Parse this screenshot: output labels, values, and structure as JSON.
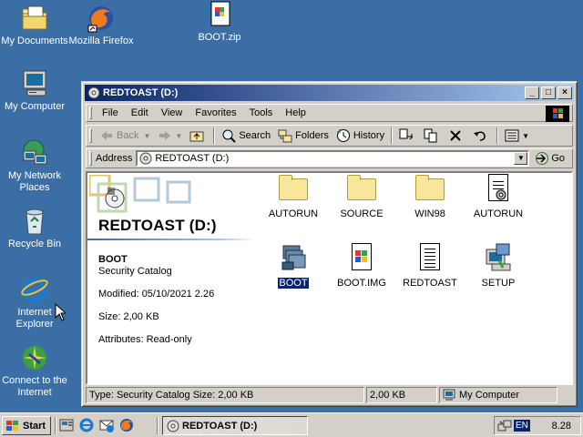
{
  "desktop": {
    "icons": [
      {
        "label": "My Documents",
        "icon": "my-documents-icon"
      },
      {
        "label": "Mozilla Firefox",
        "icon": "firefox-icon"
      },
      {
        "label": "BOOT.zip",
        "icon": "zip-file-icon"
      },
      {
        "label": "My Computer",
        "icon": "my-computer-icon"
      },
      {
        "label": "My Network Places",
        "icon": "network-places-icon"
      },
      {
        "label": "Recycle Bin",
        "icon": "recycle-bin-icon"
      },
      {
        "label": "Internet Explorer",
        "icon": "internet-explorer-icon"
      },
      {
        "label": "Connect to the Internet",
        "icon": "connect-internet-icon"
      }
    ]
  },
  "window": {
    "title": "REDTOAST (D:)",
    "controls": {
      "minimize": "_",
      "maximize": "□",
      "close": "×"
    },
    "menu": [
      "File",
      "Edit",
      "View",
      "Favorites",
      "Tools",
      "Help"
    ],
    "toolbar": {
      "back": "Back",
      "search": "Search",
      "folders": "Folders",
      "history": "History"
    },
    "address": {
      "label": "Address",
      "value": "REDTOAST (D:)",
      "go": "Go"
    },
    "left_panel": {
      "heading": "REDTOAST (D:)",
      "selected_name": "BOOT",
      "selected_type": "Security Catalog",
      "modified": "Modified: 05/10/2021 2.26",
      "size": "Size: 2,00 KB",
      "attributes": "Attributes: Read-only"
    },
    "files": [
      {
        "label": "AUTORUN",
        "kind": "folder"
      },
      {
        "label": "SOURCE",
        "kind": "folder"
      },
      {
        "label": "WIN98",
        "kind": "folder"
      },
      {
        "label": "AUTORUN",
        "kind": "settings-file"
      },
      {
        "label": "BOOT",
        "kind": "security-catalog",
        "selected": true
      },
      {
        "label": "BOOT.IMG",
        "kind": "image-file"
      },
      {
        "label": "REDTOAST",
        "kind": "text-file"
      },
      {
        "label": "SETUP",
        "kind": "setup-exe"
      }
    ],
    "status": {
      "type_text": "Type: Security Catalog Size: 2,00 KB",
      "size_text": "2,00 KB",
      "zone_text": "My Computer"
    }
  },
  "taskbar": {
    "start_label": "Start",
    "task_label": "REDTOAST (D:)",
    "lang": "EN",
    "clock": "8.28"
  },
  "colors": {
    "desktop": "#3a6ea5",
    "title_start": "#0a246a",
    "title_end": "#a6caf0",
    "selection": "#0a246a"
  }
}
